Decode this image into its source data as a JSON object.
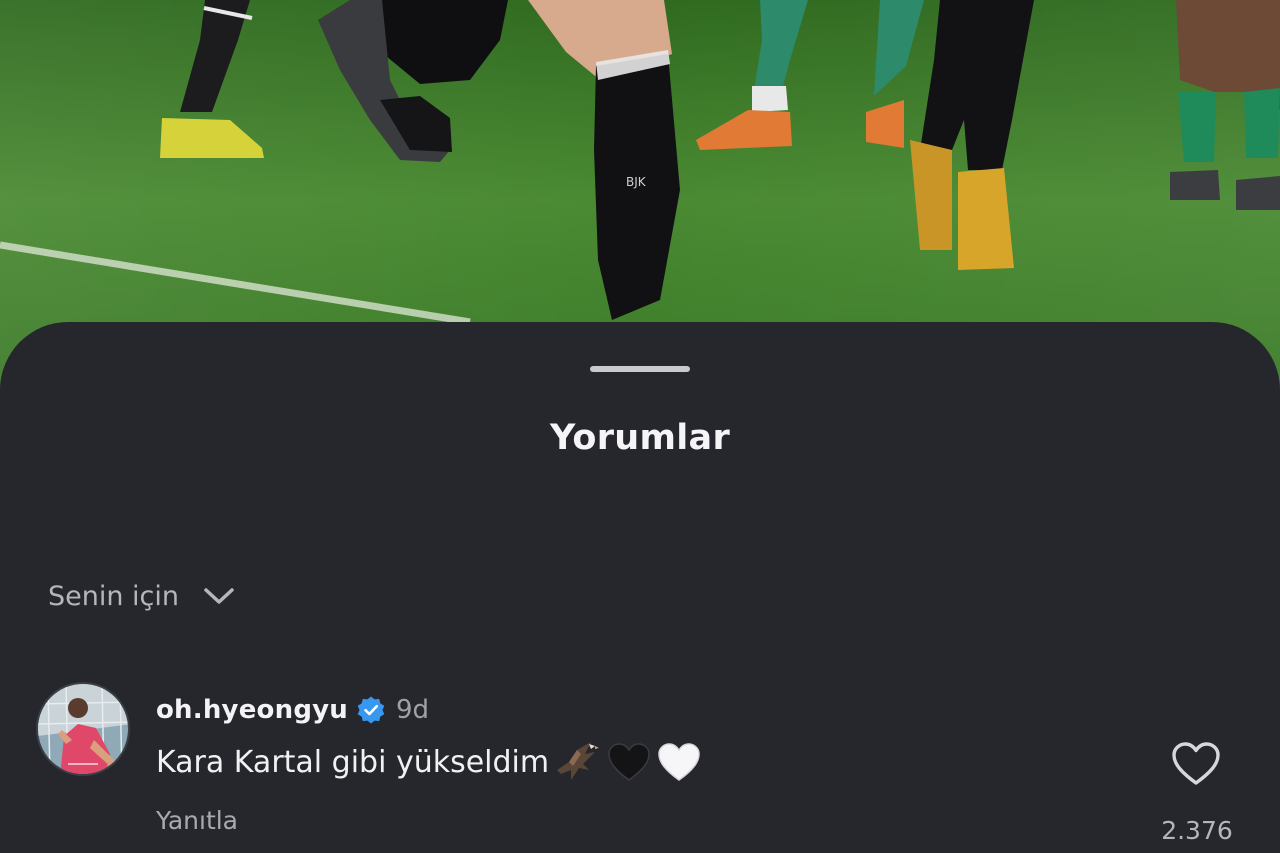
{
  "sheet": {
    "title": "Yorumlar",
    "sort": {
      "label": "Senin için",
      "icon": "chevron-down-icon"
    }
  },
  "comment": {
    "username": "oh.hyeongyu",
    "verified_icon": "verified-badge-icon",
    "timestamp": "9d",
    "text": "Kara Kartal gibi yükseldim",
    "emojis": [
      "eagle-icon",
      "black-heart-icon",
      "white-heart-icon"
    ],
    "reply_label": "Yanıtla",
    "like_icon": "heart-outline-icon",
    "like_count": "2.376"
  },
  "colors": {
    "sheet_bg": "#26272d",
    "verified": "#3897f0",
    "pitch": "#3d7a29"
  }
}
